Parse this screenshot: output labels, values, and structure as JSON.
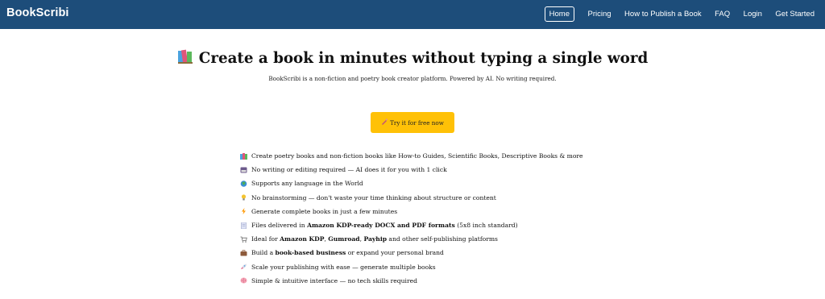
{
  "navbar": {
    "brand": "BookScribi",
    "links": [
      "Home",
      "Pricing",
      "How to Publish a Book",
      "FAQ",
      "Login",
      "Get Started"
    ],
    "active": "Home",
    "background": "#1d4d7a"
  },
  "hero": {
    "icon": "books-icon",
    "title": "Create a book in minutes without typing a single word",
    "subtitle": "BookScribi is a non-fiction and poetry book creator platform. Powered by AI. No writing required."
  },
  "cta": {
    "icon": "pen-icon",
    "label": "Try it for free now",
    "color": "#ffc107"
  },
  "features": [
    {
      "icon": "books-icon",
      "parts": [
        {
          "t": "Create poetry books and non-fiction books like How-to Guides, Scientific Books, Descriptive Books & more"
        }
      ]
    },
    {
      "icon": "no-typing-icon",
      "parts": [
        {
          "t": "No writing or editing required — AI does it for you with 1 click"
        }
      ]
    },
    {
      "icon": "globe-icon",
      "parts": [
        {
          "t": "Supports any language in the World"
        }
      ]
    },
    {
      "icon": "lightbulb-icon",
      "parts": [
        {
          "t": "No brainstorming — don't waste your time thinking about structure or content"
        }
      ]
    },
    {
      "icon": "lightning-icon",
      "parts": [
        {
          "t": "Generate complete books in just a few minutes"
        }
      ]
    },
    {
      "icon": "document-icon",
      "parts": [
        {
          "t": "Files delivered in "
        },
        {
          "t": "Amazon KDP-ready DOCX and PDF formats",
          "b": true
        },
        {
          "t": " (5x8 inch standard)"
        }
      ]
    },
    {
      "icon": "cart-icon",
      "parts": [
        {
          "t": "Ideal for "
        },
        {
          "t": "Amazon KDP",
          "b": true
        },
        {
          "t": ", "
        },
        {
          "t": "Gumroad",
          "b": true
        },
        {
          "t": ", "
        },
        {
          "t": "Payhip",
          "b": true
        },
        {
          "t": " and other self-publishing platforms"
        }
      ]
    },
    {
      "icon": "briefcase-icon",
      "parts": [
        {
          "t": "Build a "
        },
        {
          "t": "book-based business",
          "b": true
        },
        {
          "t": " or expand your personal brand"
        }
      ]
    },
    {
      "icon": "rocket-icon",
      "parts": [
        {
          "t": "Scale your publishing with ease — generate multiple books"
        }
      ]
    },
    {
      "icon": "brain-icon",
      "parts": [
        {
          "t": "Simple & intuitive interface — no tech skills required"
        }
      ]
    }
  ]
}
